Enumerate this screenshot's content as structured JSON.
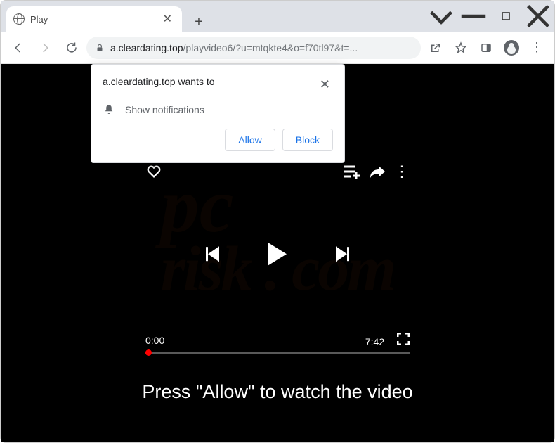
{
  "window": {
    "tab_title": "Play",
    "tab_close_tooltip": "Close",
    "newtab_tooltip": "New tab"
  },
  "toolbar": {
    "url_host": "a.cleardating.top",
    "url_path": "/playvideo6/?u=mtqkte4&o=f70tl97&t=..."
  },
  "icons": {
    "back": "back-arrow",
    "forward": "forward-arrow",
    "reload": "reload",
    "lock": "lock",
    "share": "share",
    "star": "bookmark-star",
    "side_panel": "side-panel",
    "profile": "profile",
    "menu": "menu",
    "win_collapse": "collapse",
    "win_min": "minimize",
    "win_max": "maximize",
    "win_close": "close"
  },
  "permission": {
    "origin_wants_to": "a.cleardating.top wants to",
    "notif_label": "Show notifications",
    "allow": "Allow",
    "block": "Block"
  },
  "player": {
    "current_time": "0:00",
    "duration": "7:42"
  },
  "cta_text": "Press \"Allow\" to watch the video"
}
